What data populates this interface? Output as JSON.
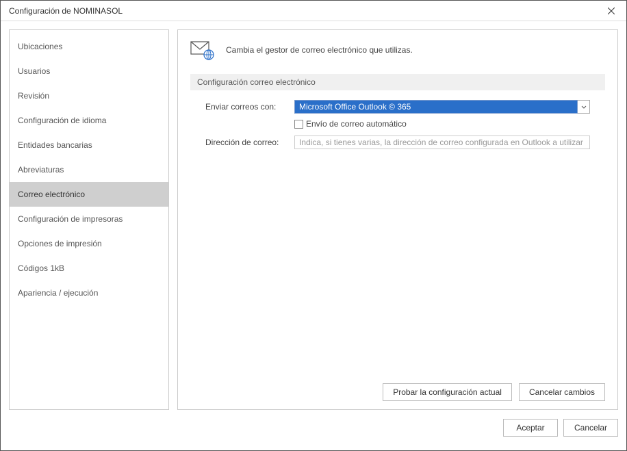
{
  "window": {
    "title": "Configuración de NOMINASOL"
  },
  "sidebar": {
    "items": [
      {
        "label": "Ubicaciones"
      },
      {
        "label": "Usuarios"
      },
      {
        "label": "Revisión"
      },
      {
        "label": "Configuración de idioma"
      },
      {
        "label": "Entidades bancarias"
      },
      {
        "label": "Abreviaturas"
      },
      {
        "label": "Correo electrónico"
      },
      {
        "label": "Configuración de impresoras"
      },
      {
        "label": "Opciones de impresión"
      },
      {
        "label": "Códigos 1kB"
      },
      {
        "label": "Apariencia / ejecución"
      }
    ],
    "selected_index": 6
  },
  "main": {
    "header_desc": "Cambia el gestor de correo electrónico que utilizas.",
    "section_title": "Configuración correo electrónico",
    "send_with_label": "Enviar correos con:",
    "send_with_value": "Microsoft Office Outlook © 365",
    "auto_send_label": "Envío de correo automático",
    "auto_send_checked": false,
    "address_label": "Dirección de correo:",
    "address_placeholder": "Indica, si tienes varias, la dirección de correo configurada en Outlook a utilizar",
    "address_value": "",
    "btn_test": "Probar la configuración actual",
    "btn_cancel_changes": "Cancelar cambios"
  },
  "footer": {
    "btn_accept": "Aceptar",
    "btn_cancel": "Cancelar"
  }
}
